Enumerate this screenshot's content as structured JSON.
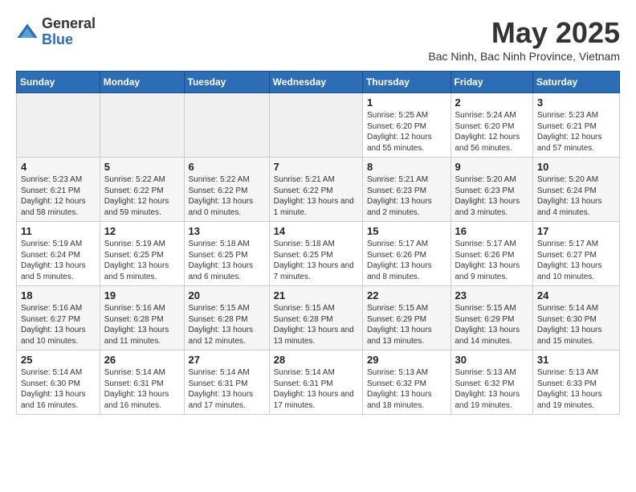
{
  "logo": {
    "line1": "General",
    "line2": "Blue"
  },
  "title": "May 2025",
  "subtitle": "Bac Ninh, Bac Ninh Province, Vietnam",
  "days_of_week": [
    "Sunday",
    "Monday",
    "Tuesday",
    "Wednesday",
    "Thursday",
    "Friday",
    "Saturday"
  ],
  "weeks": [
    [
      {
        "day": "",
        "empty": true
      },
      {
        "day": "",
        "empty": true
      },
      {
        "day": "",
        "empty": true
      },
      {
        "day": "",
        "empty": true
      },
      {
        "day": "1",
        "sunrise": "Sunrise: 5:25 AM",
        "sunset": "Sunset: 6:20 PM",
        "daylight": "Daylight: 12 hours and 55 minutes."
      },
      {
        "day": "2",
        "sunrise": "Sunrise: 5:24 AM",
        "sunset": "Sunset: 6:20 PM",
        "daylight": "Daylight: 12 hours and 56 minutes."
      },
      {
        "day": "3",
        "sunrise": "Sunrise: 5:23 AM",
        "sunset": "Sunset: 6:21 PM",
        "daylight": "Daylight: 12 hours and 57 minutes."
      }
    ],
    [
      {
        "day": "4",
        "sunrise": "Sunrise: 5:23 AM",
        "sunset": "Sunset: 6:21 PM",
        "daylight": "Daylight: 12 hours and 58 minutes."
      },
      {
        "day": "5",
        "sunrise": "Sunrise: 5:22 AM",
        "sunset": "Sunset: 6:22 PM",
        "daylight": "Daylight: 12 hours and 59 minutes."
      },
      {
        "day": "6",
        "sunrise": "Sunrise: 5:22 AM",
        "sunset": "Sunset: 6:22 PM",
        "daylight": "Daylight: 13 hours and 0 minutes."
      },
      {
        "day": "7",
        "sunrise": "Sunrise: 5:21 AM",
        "sunset": "Sunset: 6:22 PM",
        "daylight": "Daylight: 13 hours and 1 minute."
      },
      {
        "day": "8",
        "sunrise": "Sunrise: 5:21 AM",
        "sunset": "Sunset: 6:23 PM",
        "daylight": "Daylight: 13 hours and 2 minutes."
      },
      {
        "day": "9",
        "sunrise": "Sunrise: 5:20 AM",
        "sunset": "Sunset: 6:23 PM",
        "daylight": "Daylight: 13 hours and 3 minutes."
      },
      {
        "day": "10",
        "sunrise": "Sunrise: 5:20 AM",
        "sunset": "Sunset: 6:24 PM",
        "daylight": "Daylight: 13 hours and 4 minutes."
      }
    ],
    [
      {
        "day": "11",
        "sunrise": "Sunrise: 5:19 AM",
        "sunset": "Sunset: 6:24 PM",
        "daylight": "Daylight: 13 hours and 5 minutes."
      },
      {
        "day": "12",
        "sunrise": "Sunrise: 5:19 AM",
        "sunset": "Sunset: 6:25 PM",
        "daylight": "Daylight: 13 hours and 5 minutes."
      },
      {
        "day": "13",
        "sunrise": "Sunrise: 5:18 AM",
        "sunset": "Sunset: 6:25 PM",
        "daylight": "Daylight: 13 hours and 6 minutes."
      },
      {
        "day": "14",
        "sunrise": "Sunrise: 5:18 AM",
        "sunset": "Sunset: 6:25 PM",
        "daylight": "Daylight: 13 hours and 7 minutes."
      },
      {
        "day": "15",
        "sunrise": "Sunrise: 5:17 AM",
        "sunset": "Sunset: 6:26 PM",
        "daylight": "Daylight: 13 hours and 8 minutes."
      },
      {
        "day": "16",
        "sunrise": "Sunrise: 5:17 AM",
        "sunset": "Sunset: 6:26 PM",
        "daylight": "Daylight: 13 hours and 9 minutes."
      },
      {
        "day": "17",
        "sunrise": "Sunrise: 5:17 AM",
        "sunset": "Sunset: 6:27 PM",
        "daylight": "Daylight: 13 hours and 10 minutes."
      }
    ],
    [
      {
        "day": "18",
        "sunrise": "Sunrise: 5:16 AM",
        "sunset": "Sunset: 6:27 PM",
        "daylight": "Daylight: 13 hours and 10 minutes."
      },
      {
        "day": "19",
        "sunrise": "Sunrise: 5:16 AM",
        "sunset": "Sunset: 6:28 PM",
        "daylight": "Daylight: 13 hours and 11 minutes."
      },
      {
        "day": "20",
        "sunrise": "Sunrise: 5:15 AM",
        "sunset": "Sunset: 6:28 PM",
        "daylight": "Daylight: 13 hours and 12 minutes."
      },
      {
        "day": "21",
        "sunrise": "Sunrise: 5:15 AM",
        "sunset": "Sunset: 6:28 PM",
        "daylight": "Daylight: 13 hours and 13 minutes."
      },
      {
        "day": "22",
        "sunrise": "Sunrise: 5:15 AM",
        "sunset": "Sunset: 6:29 PM",
        "daylight": "Daylight: 13 hours and 13 minutes."
      },
      {
        "day": "23",
        "sunrise": "Sunrise: 5:15 AM",
        "sunset": "Sunset: 6:29 PM",
        "daylight": "Daylight: 13 hours and 14 minutes."
      },
      {
        "day": "24",
        "sunrise": "Sunrise: 5:14 AM",
        "sunset": "Sunset: 6:30 PM",
        "daylight": "Daylight: 13 hours and 15 minutes."
      }
    ],
    [
      {
        "day": "25",
        "sunrise": "Sunrise: 5:14 AM",
        "sunset": "Sunset: 6:30 PM",
        "daylight": "Daylight: 13 hours and 16 minutes."
      },
      {
        "day": "26",
        "sunrise": "Sunrise: 5:14 AM",
        "sunset": "Sunset: 6:31 PM",
        "daylight": "Daylight: 13 hours and 16 minutes."
      },
      {
        "day": "27",
        "sunrise": "Sunrise: 5:14 AM",
        "sunset": "Sunset: 6:31 PM",
        "daylight": "Daylight: 13 hours and 17 minutes."
      },
      {
        "day": "28",
        "sunrise": "Sunrise: 5:14 AM",
        "sunset": "Sunset: 6:31 PM",
        "daylight": "Daylight: 13 hours and 17 minutes."
      },
      {
        "day": "29",
        "sunrise": "Sunrise: 5:13 AM",
        "sunset": "Sunset: 6:32 PM",
        "daylight": "Daylight: 13 hours and 18 minutes."
      },
      {
        "day": "30",
        "sunrise": "Sunrise: 5:13 AM",
        "sunset": "Sunset: 6:32 PM",
        "daylight": "Daylight: 13 hours and 19 minutes."
      },
      {
        "day": "31",
        "sunrise": "Sunrise: 5:13 AM",
        "sunset": "Sunset: 6:33 PM",
        "daylight": "Daylight: 13 hours and 19 minutes."
      }
    ]
  ]
}
